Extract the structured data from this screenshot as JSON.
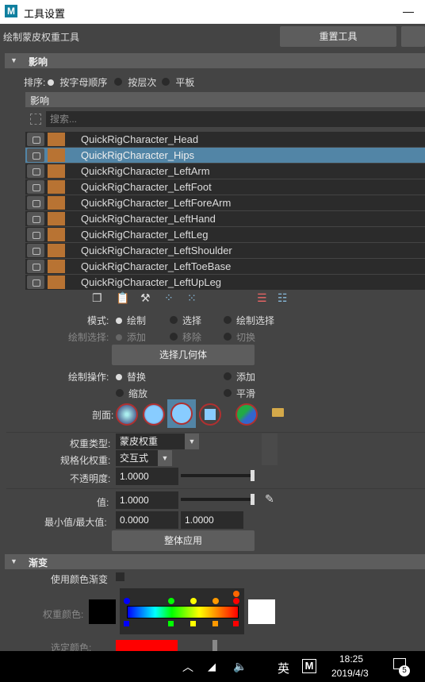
{
  "window": {
    "title": "工具设置",
    "logo": "M"
  },
  "tool": {
    "name": "绘制蒙皮权重工具",
    "reset_label": "重置工具"
  },
  "influence_section": {
    "header": "影响",
    "sort_label": "排序:",
    "sort_options": [
      "按字母顺序",
      "按层次",
      "平板"
    ],
    "sort_selected": 0,
    "sub_header": "影响",
    "search_placeholder": "搜索...",
    "items": [
      "QuickRigCharacter_Head",
      "QuickRigCharacter_Hips",
      "QuickRigCharacter_LeftArm",
      "QuickRigCharacter_LeftFoot",
      "QuickRigCharacter_LeftForeArm",
      "QuickRigCharacter_LeftHand",
      "QuickRigCharacter_LeftLeg",
      "QuickRigCharacter_LeftShoulder",
      "QuickRigCharacter_LeftToeBase",
      "QuickRigCharacter_LeftUpLeg"
    ],
    "selected_item": 1,
    "item_color": "#b87333"
  },
  "mode": {
    "label": "模式:",
    "options": [
      "绘制",
      "选择",
      "绘制选择"
    ],
    "selected": 0
  },
  "paint_select": {
    "label": "绘制选择:",
    "options": [
      "添加",
      "移除",
      "切换"
    ]
  },
  "select_geometry_label": "选择几何体",
  "paint_op": {
    "label": "绘制操作:",
    "options": [
      "替换",
      "添加",
      "缩放",
      "平滑"
    ],
    "selected": 0
  },
  "profile": {
    "label": "剖面:"
  },
  "weight_type": {
    "label": "权重类型:",
    "value": "蒙皮权重"
  },
  "normalize": {
    "label": "规格化权重:",
    "value": "交互式"
  },
  "opacity": {
    "label": "不透明度:",
    "value": "1.0000",
    "level": 1.0
  },
  "value": {
    "label": "值:",
    "value": "1.0000",
    "level": 1.0
  },
  "minmax": {
    "label": "最小值/最大值:",
    "min": "0.0000",
    "max": "1.0000"
  },
  "flood_label": "整体应用",
  "gradient_section": {
    "header": "渐变",
    "use_color_label": "使用颜色渐变",
    "weight_color_label": "权重颜色:",
    "selected_color_label": "选定颜色:"
  },
  "taskbar": {
    "ime": "英",
    "app_icon": "M",
    "time": "18:25",
    "date": "2019/4/3",
    "notification_count": "5"
  }
}
